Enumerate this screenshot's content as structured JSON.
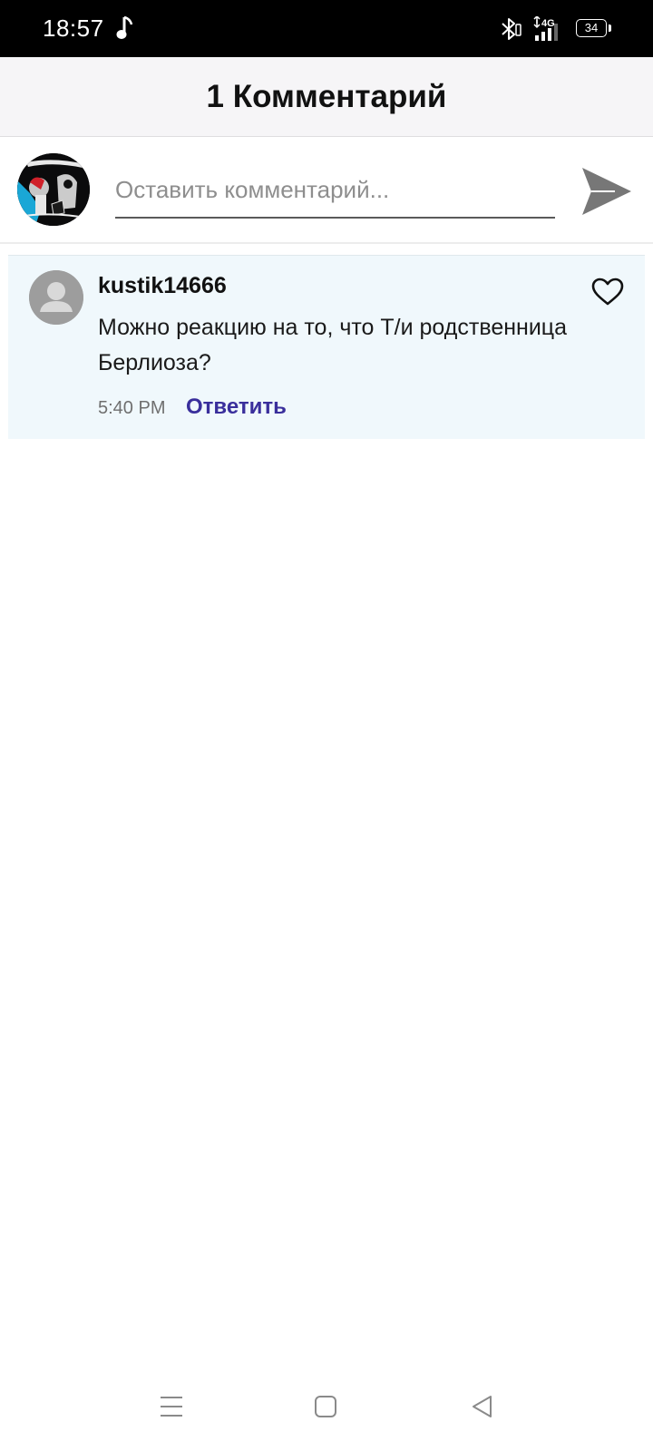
{
  "status_bar": {
    "time": "18:57",
    "battery": "34",
    "network": "4G",
    "icons": [
      "music-note-icon",
      "bluetooth-icon",
      "signal-icon",
      "battery-icon"
    ]
  },
  "header": {
    "title": "1 Комментарий"
  },
  "composer": {
    "placeholder": "Оставить комментарий...",
    "value": "",
    "send_icon": "send-icon"
  },
  "comments": [
    {
      "author": "kustik14666",
      "text": "Можно реакцию на то, что Т/и родственница Берлиоза?",
      "time": "5:40 PM",
      "reply_label": "Ответить",
      "like_icon": "heart-outline-icon"
    }
  ],
  "nav_bar": {
    "icons": [
      "menu-icon",
      "home-icon",
      "back-icon"
    ]
  },
  "colors": {
    "status_bar_bg": "#000000",
    "header_bg": "#f6f5f7",
    "comment_bg": "#f0f8fc",
    "reply_link": "#3a2f9c",
    "send_icon": "#777777"
  }
}
